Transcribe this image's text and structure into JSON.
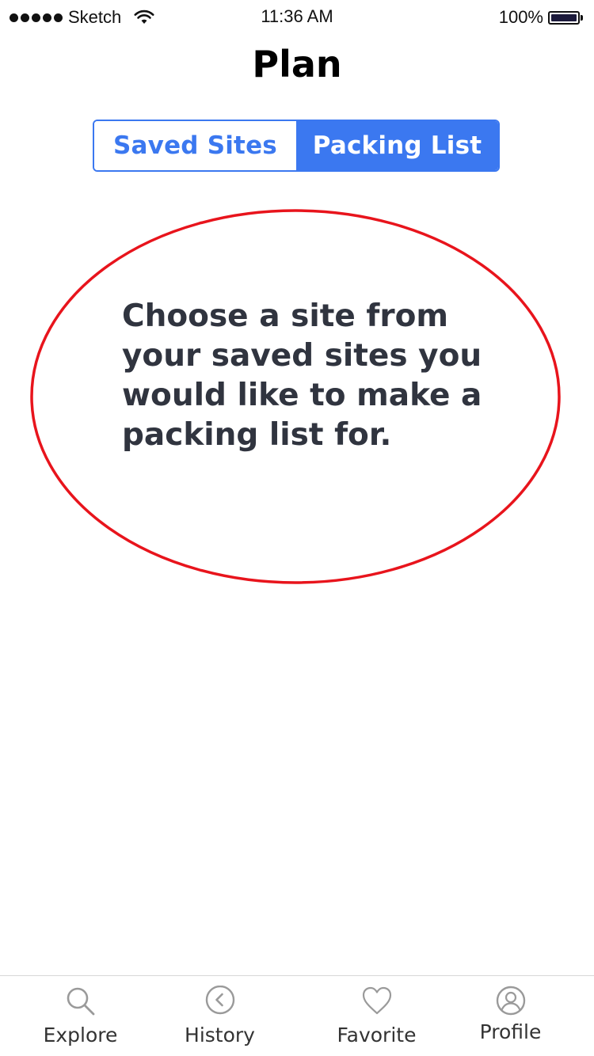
{
  "status_bar": {
    "carrier": "Sketch",
    "time": "11:36 AM",
    "battery": "100%"
  },
  "header": {
    "title": "Plan"
  },
  "segmented_control": {
    "options": [
      {
        "label": "Saved Sites",
        "selected": false
      },
      {
        "label": "Packing List",
        "selected": true
      }
    ]
  },
  "main": {
    "message": "Choose a site from your saved sites you would like to make a packing list for."
  },
  "tab_bar": {
    "items": [
      {
        "label": "Explore",
        "icon": "search-icon"
      },
      {
        "label": "History",
        "icon": "chevron-left-circle-icon"
      },
      {
        "label": "Favorite",
        "icon": "heart-icon"
      },
      {
        "label": "Profile",
        "icon": "user-circle-icon"
      }
    ]
  },
  "colors": {
    "accent": "#3b78f0",
    "annotation": "#e8141c",
    "message_text": "#30343f"
  }
}
